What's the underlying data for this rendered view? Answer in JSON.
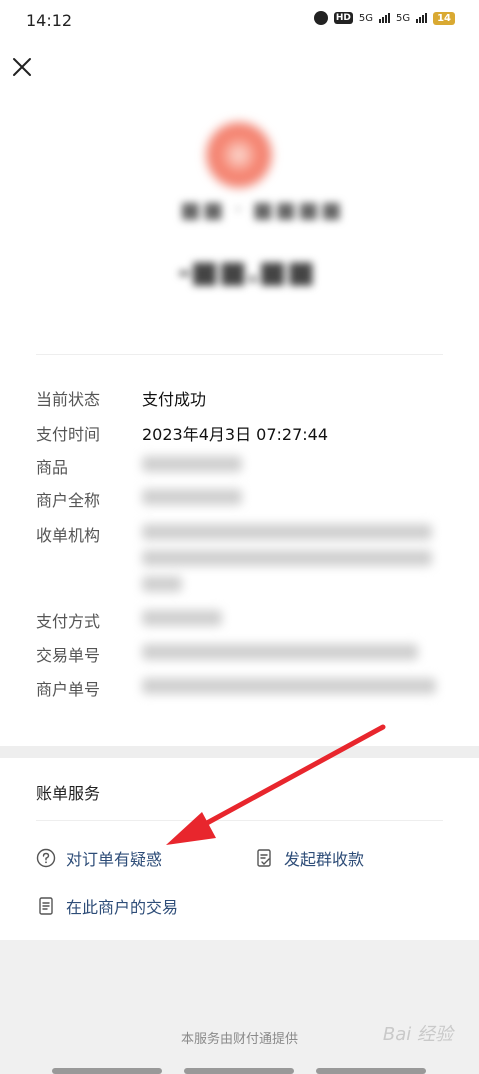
{
  "status_bar": {
    "time": "14:12",
    "network": "5G",
    "network2": "5G",
    "hd_label": "HD",
    "battery": "14"
  },
  "header": {
    "close_icon": "close-icon"
  },
  "details": {
    "status_label": "当前状态",
    "status_value": "支付成功",
    "time_label": "支付时间",
    "time_value": "2023年4月3日 07:27:44",
    "product_label": "商品",
    "merchant_label": "商户全称",
    "acquirer_label": "收单机构",
    "method_label": "支付方式",
    "txn_label": "交易单号",
    "merchant_no_label": "商户单号"
  },
  "bill_service": {
    "title": "账单服务",
    "actions": {
      "doubt": "对订单有疑惑",
      "group_collect": "发起群收款",
      "merchant_txns": "在此商户的交易"
    }
  },
  "footer": {
    "provider": "本服务由财付通提供",
    "watermark": "Bai 经验"
  },
  "colors": {
    "link": "#2e4d78",
    "arrow": "#e8262d",
    "battery": "#d9a932"
  }
}
